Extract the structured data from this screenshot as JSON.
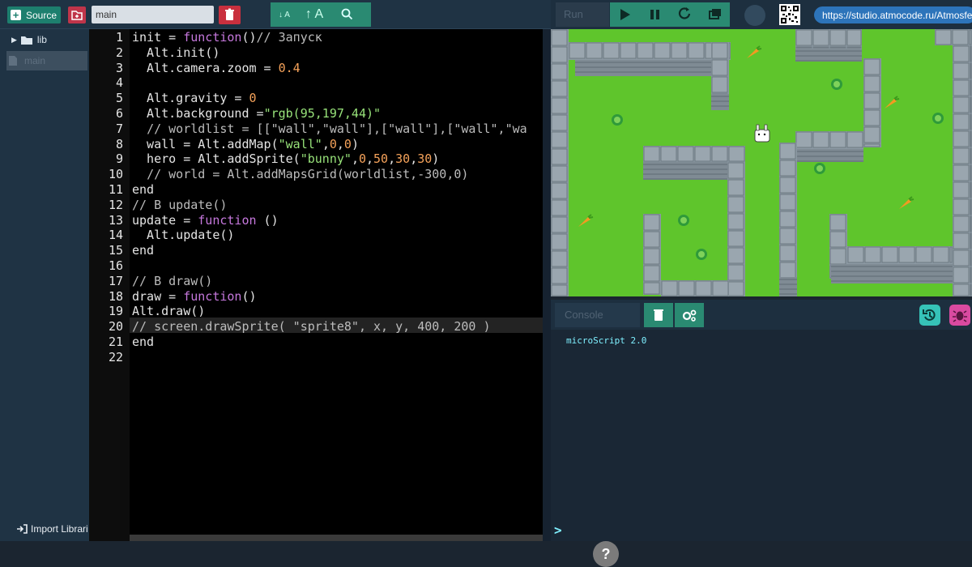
{
  "toolbar": {
    "source_label": "Source",
    "filename_value": "main",
    "font_smaller": "↓ A",
    "font_larger": "↑ A"
  },
  "run_panel": {
    "run_label": "Run",
    "url": "https://studio.atmocode.ru/Atmosfera"
  },
  "sidebar": {
    "items": [
      {
        "label": "lib"
      },
      {
        "label": "main"
      }
    ],
    "import_label": "Import Librari"
  },
  "editor": {
    "line_numbers": [
      "1",
      "2",
      "3",
      "4",
      "5",
      "6",
      "7",
      "8",
      "9",
      "10",
      "11",
      "12",
      "13",
      "14",
      "15",
      "16",
      "17",
      "18",
      "19",
      "20",
      "21",
      "22"
    ],
    "lines": [
      "init = function()// Запуск",
      "  Alt.init()",
      "  Alt.camera.zoom = 0.4",
      "",
      "  Alt.gravity = 0",
      "  Alt.background =\"rgb(95,197,44)\"",
      "  // worldlist = [[\"wall\",\"wall\"],[\"wall\"],[\"wall\",\"wa",
      "  wall = Alt.addMap(\"wall\",0,0)",
      "  hero = Alt.addSprite(\"bunny\",0,50,30,30)",
      "  // world = Alt.addMapsGrid(worldlist,-300,0)",
      "end",
      "// В update()",
      "update = function ()",
      "  Alt.update()",
      "end",
      "",
      "// В draw()",
      "draw = function()",
      "Alt.draw()",
      "// screen.drawSprite( \"sprite8\", x, y, 400, 200 )",
      "end",
      ""
    ],
    "help_label": "?"
  },
  "console": {
    "label": "Console",
    "output": "microScript 2.0",
    "prompt": ">"
  },
  "colors": {
    "game_background": "#5fc52c",
    "accent": "#2a8a72",
    "danger": "#c9303e"
  }
}
